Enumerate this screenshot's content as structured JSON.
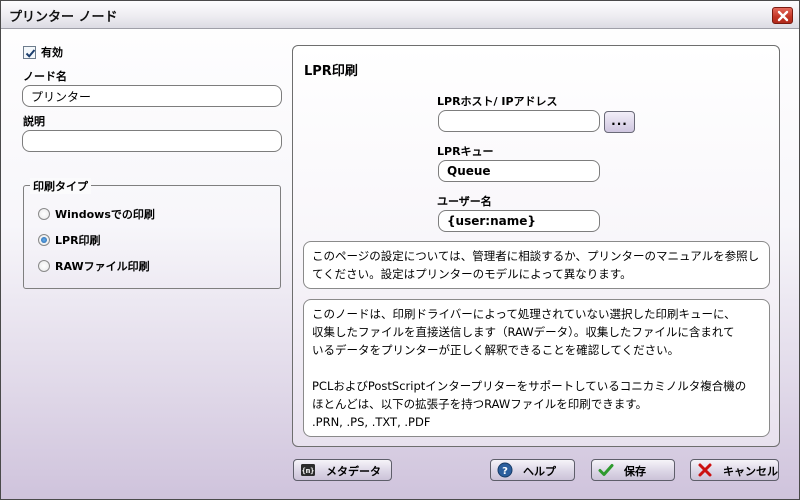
{
  "window": {
    "title": "プリンター ノード"
  },
  "left": {
    "enabled_label": "有効",
    "enabled_checked": true,
    "node_name_label": "ノード名",
    "node_name_value": "プリンター",
    "description_label": "説明",
    "description_value": "",
    "print_type": {
      "legend": "印刷タイプ",
      "options": [
        "Windowsでの印刷",
        "LPR印刷",
        "RAWファイル印刷"
      ],
      "selected": "LPR印刷"
    }
  },
  "panel": {
    "title": "LPR印刷",
    "host_label": "LPRホスト/ IPアドレス",
    "host_value": "",
    "browse_label": "...",
    "queue_label": "LPRキュー",
    "queue_value": "Queue",
    "user_label": "ユーザー名",
    "user_value": "{user:name}",
    "note1": "このページの設定については、管理者に相談するか、プリンターのマニュアルを参照してください。設定はプリンターのモデルによって異なります。",
    "note2_lines": [
      "このノードは、印刷ドライバーによって処理されていない選択した印刷キューに、",
      "収集したファイルを直接送信します（RAWデータ）。収集したファイルに含まれて",
      "いるデータをプリンターが正しく解釈できることを確認してください。",
      "",
      "PCLおよびPostScriptインタープリターをサポートしているコニカミノルタ複合機の",
      "ほとんどは、以下の拡張子を持つRAWファイルを印刷できます。",
      ".PRN, .PS, .TXT, .PDF"
    ]
  },
  "buttons": {
    "metadata": "メタデータ",
    "help": "ヘルプ",
    "save": "保存",
    "cancel": "キャンセル"
  },
  "colors": {
    "accent": "#1e5fa8",
    "save_check": "#2e9a2e",
    "cancel_x": "#cc1111",
    "help_icon": "#2c5f9e"
  }
}
